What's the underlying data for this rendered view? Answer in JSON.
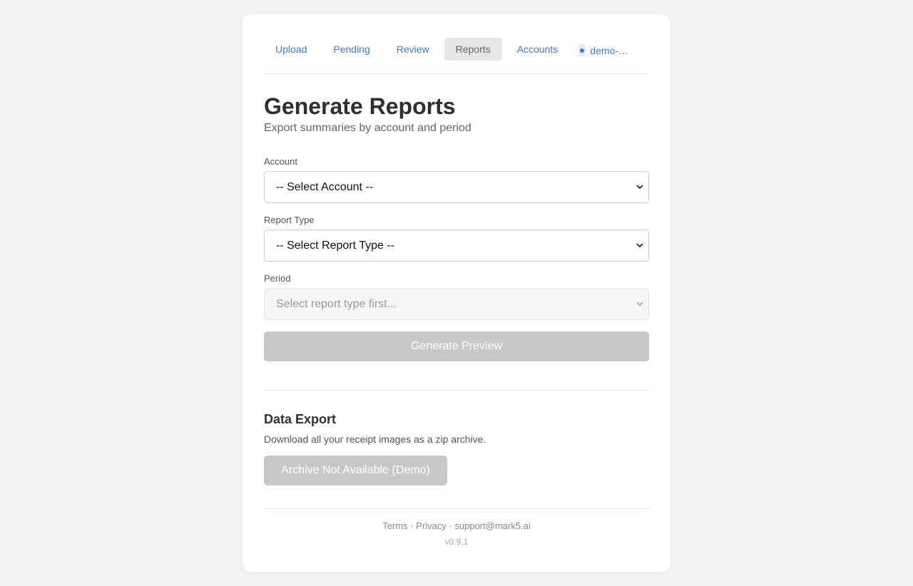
{
  "nav": {
    "items": [
      {
        "label": "Upload",
        "active": false
      },
      {
        "label": "Pending",
        "active": false
      },
      {
        "label": "Review",
        "active": false
      },
      {
        "label": "Reports",
        "active": true
      },
      {
        "label": "Accounts",
        "active": false
      }
    ],
    "user_label": "demo-…"
  },
  "page": {
    "title": "Generate Reports",
    "subtitle": "Export summaries by account and period"
  },
  "form": {
    "account": {
      "label": "Account",
      "value": "-- Select Account --"
    },
    "report_type": {
      "label": "Report Type",
      "value": "-- Select Report Type --"
    },
    "period": {
      "label": "Period",
      "value": "Select report type first...",
      "disabled": true
    },
    "preview_button": "Generate Preview"
  },
  "export": {
    "title": "Data Export",
    "description": "Download all your receipt images as a zip archive.",
    "button": "Archive Not Available (Demo)"
  },
  "footer": {
    "terms": "Terms",
    "separator": "·",
    "privacy": "Privacy",
    "email": "support@mark5.ai",
    "version": "v0.9.1"
  },
  "colors": {
    "accent": "#3a7bd5",
    "disabled_button": "#c8c8c8",
    "background": "#f4f4f4"
  }
}
